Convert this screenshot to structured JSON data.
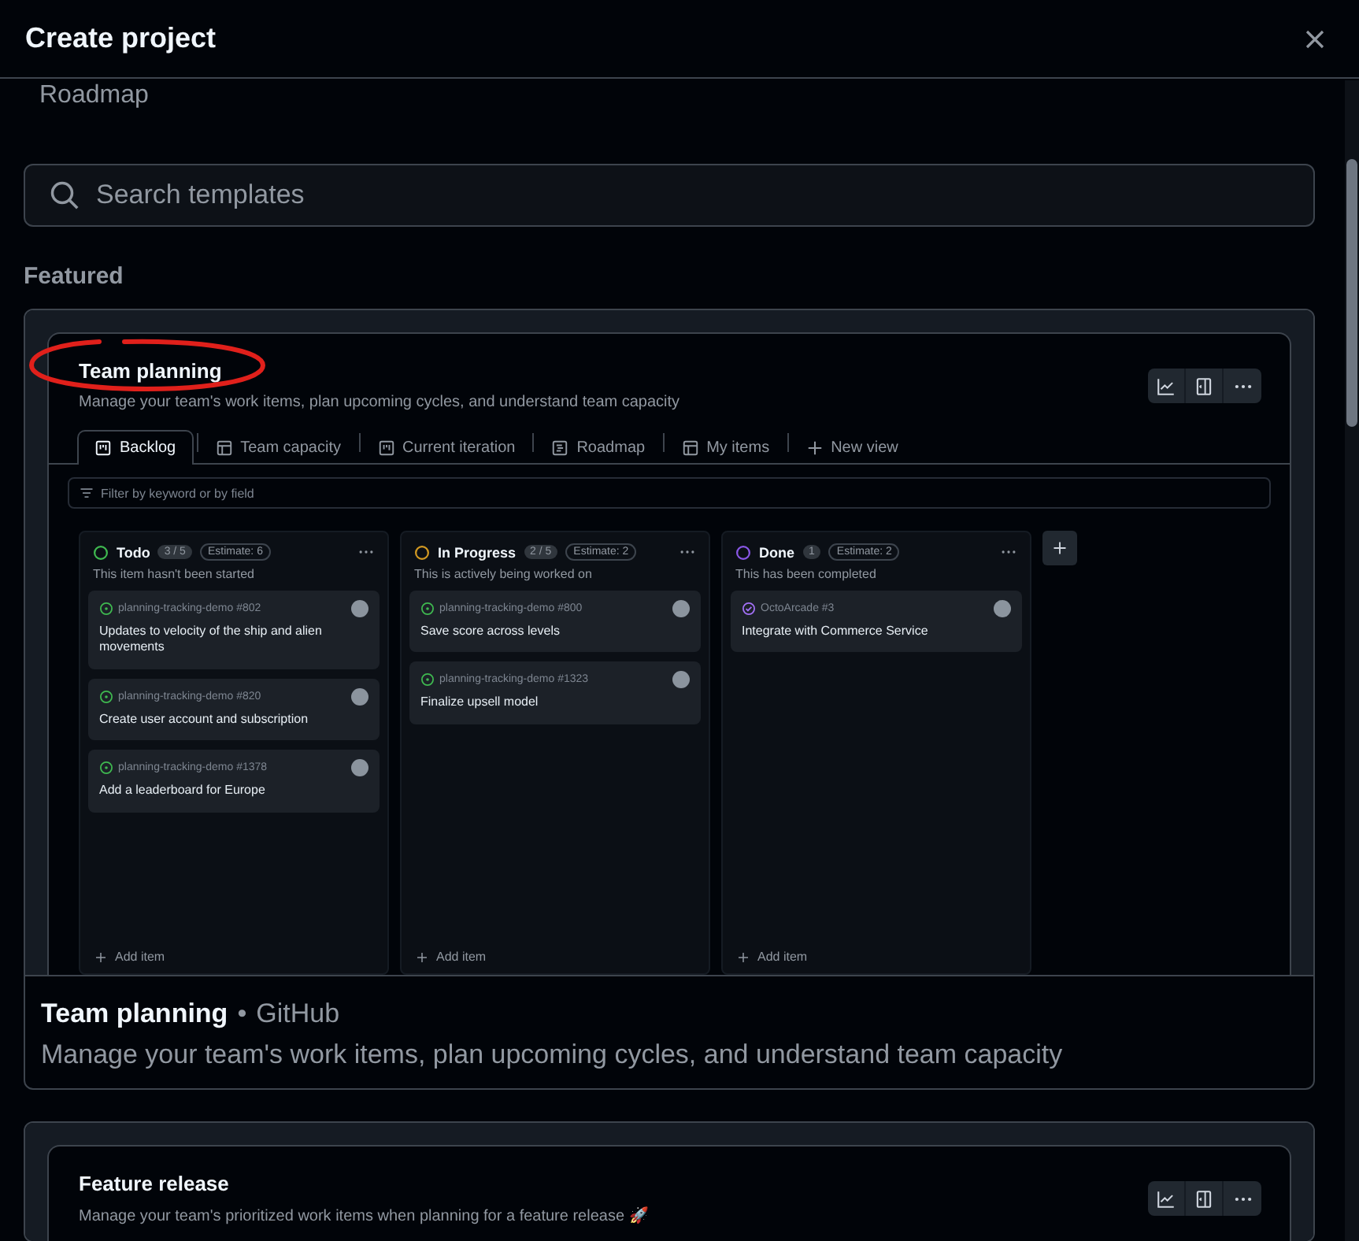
{
  "dialog": {
    "title": "Create project"
  },
  "scrolled_text": "Roadmap",
  "search": {
    "placeholder": "Search templates"
  },
  "section_heading": "Featured",
  "templates": [
    {
      "preview": {
        "title": "Team planning",
        "highlighted": true,
        "description": "Manage your team's work items, plan upcoming cycles, and understand team capacity",
        "views": [
          {
            "label": "Backlog",
            "kind": "board",
            "selected": true
          },
          {
            "label": "Team capacity",
            "kind": "table",
            "selected": false
          },
          {
            "label": "Current iteration",
            "kind": "board",
            "selected": false
          },
          {
            "label": "Roadmap",
            "kind": "roadmap",
            "selected": false
          },
          {
            "label": "My items",
            "kind": "table",
            "selected": false
          },
          {
            "label": "New view",
            "kind": "new",
            "selected": false
          }
        ],
        "filter_placeholder": "Filter by keyword or by field",
        "columns": [
          {
            "name": "Todo",
            "color": "#3fb950",
            "count": "3 / 5",
            "estimate": "Estimate: 6",
            "description": "This item hasn't been started",
            "add_label": "Add item",
            "items": [
              {
                "repo": "planning-tracking-demo #802",
                "kind": "open",
                "title": "Updates to velocity of the ship and alien movements"
              },
              {
                "repo": "planning-tracking-demo #820",
                "kind": "open",
                "title": "Create user account and subscription"
              },
              {
                "repo": "planning-tracking-demo #1378",
                "kind": "open",
                "title": "Add a leaderboard for Europe"
              }
            ]
          },
          {
            "name": "In Progress",
            "color": "#d29922",
            "count": "2 / 5",
            "estimate": "Estimate: 2",
            "description": "This is actively being worked on",
            "add_label": "Add item",
            "items": [
              {
                "repo": "planning-tracking-demo #800",
                "kind": "open",
                "title": "Save score across levels"
              },
              {
                "repo": "planning-tracking-demo #1323",
                "kind": "open",
                "title": "Finalize upsell model"
              }
            ]
          },
          {
            "name": "Done",
            "color": "#8957e5",
            "count": "1",
            "estimate": "Estimate: 2",
            "description": "This has been completed",
            "add_label": "Add item",
            "items": [
              {
                "repo": "OctoArcade #3",
                "kind": "done",
                "title": "Integrate with Commerce Service"
              }
            ]
          }
        ]
      },
      "name": "Team planning",
      "separator": "•",
      "author": "GitHub",
      "description": "Manage your team's work items, plan upcoming cycles, and understand team capacity"
    },
    {
      "preview": {
        "title": "Feature release",
        "highlighted": false,
        "description": "Manage your team's prioritized work items when planning for a feature release 🚀"
      }
    }
  ]
}
